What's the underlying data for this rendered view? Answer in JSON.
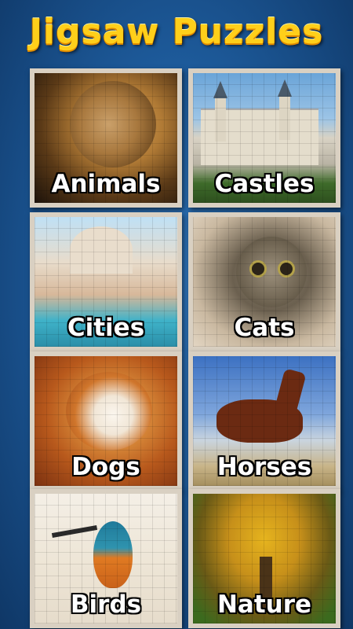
{
  "title": "Jigsaw Puzzles",
  "categories": [
    {
      "label": "Animals"
    },
    {
      "label": "Castles"
    },
    {
      "label": "Cities"
    },
    {
      "label": "Cats"
    },
    {
      "label": "Dogs"
    },
    {
      "label": "Horses"
    },
    {
      "label": "Birds"
    },
    {
      "label": "Nature"
    }
  ],
  "colors": {
    "title": "#ffcf1a",
    "background": "#1d5a9a",
    "label": "#ffffff"
  }
}
